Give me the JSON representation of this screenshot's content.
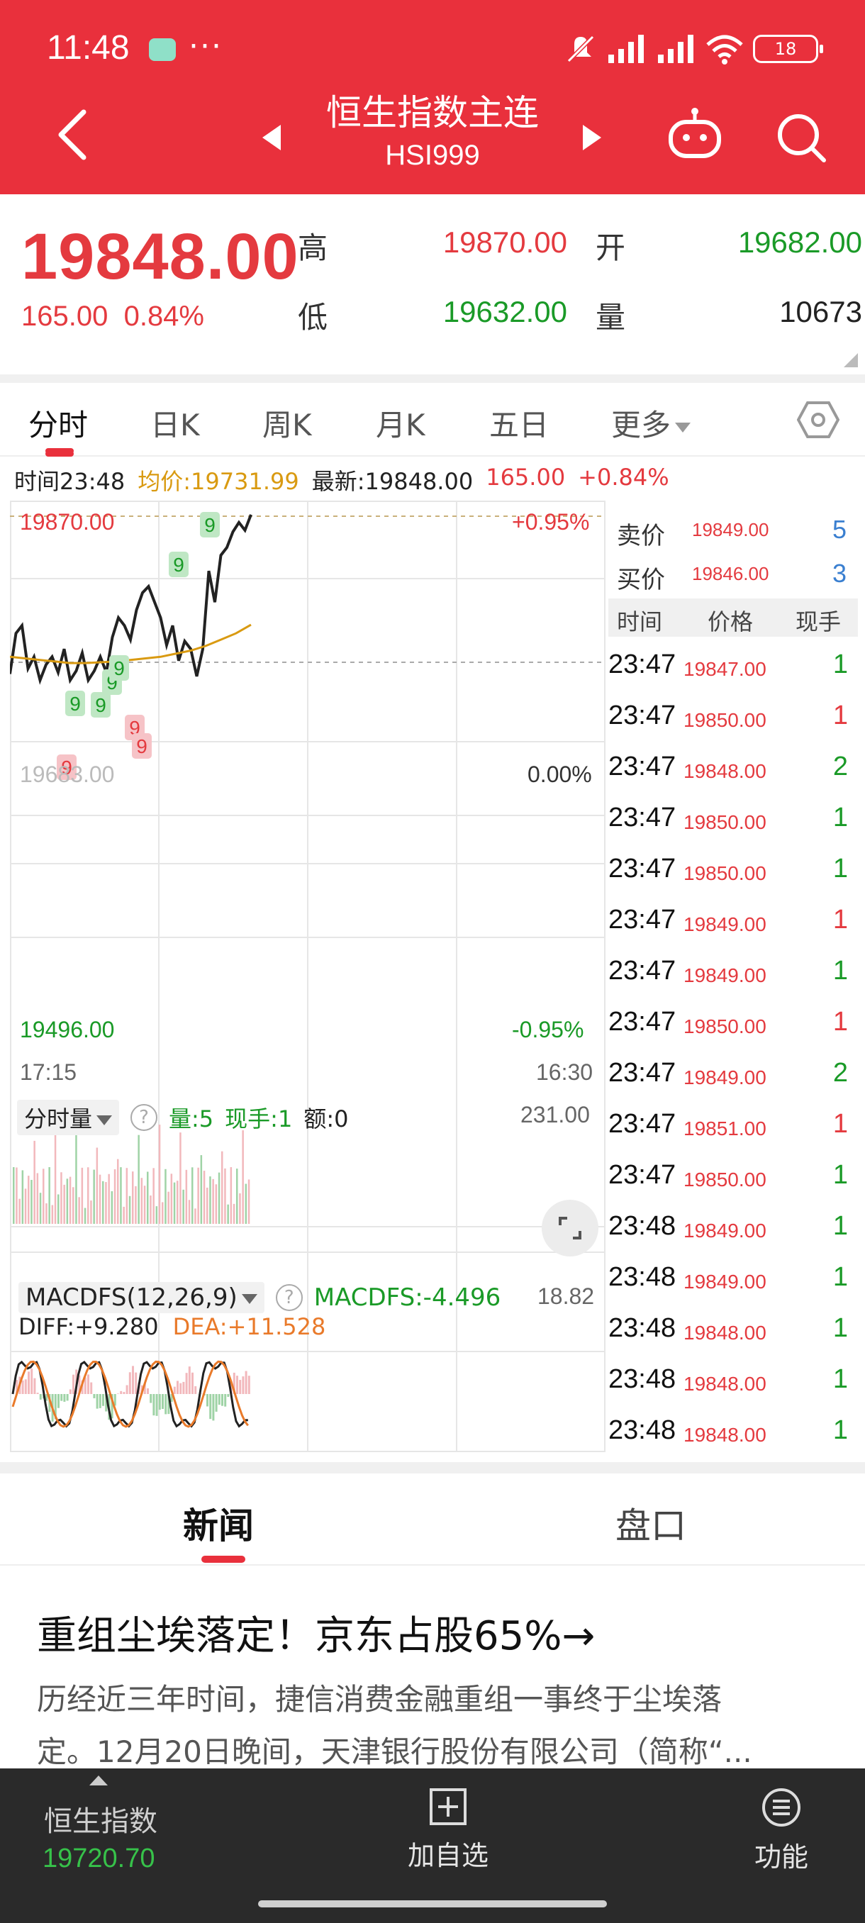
{
  "status_bar": {
    "time": "11:48",
    "dots": "···",
    "battery": "18"
  },
  "header": {
    "title": "恒生指数主连",
    "code": "HSI999"
  },
  "quote": {
    "price": "19848.00",
    "change": "165.00",
    "change_pct": "0.84%",
    "high_label": "高",
    "high": "19870.00",
    "open_label": "开",
    "open": "19682.00",
    "low_label": "低",
    "low": "19632.00",
    "volume_label": "量",
    "volume": "10673"
  },
  "tabs": [
    "分时",
    "日K",
    "周K",
    "月K",
    "五日",
    "更多"
  ],
  "info_line": {
    "time": "时间23:48",
    "avg": "均价:19731.99",
    "latest": "最新:19848.00",
    "chg": "165.00",
    "chg_pct": "+0.84%"
  },
  "axes": {
    "top": "19870.00",
    "top_pct": "+0.95%",
    "mid": "19683.00",
    "mid_pct": "0.00%",
    "bottom": "19496.00",
    "bottom_pct": "-0.95%",
    "start_time": "17:15",
    "end_time": "16:30"
  },
  "volume_panel": {
    "select": "分时量",
    "qty": "量:5",
    "hand": "现手:1",
    "amount": "额:0",
    "max": "231.00"
  },
  "macd_panel": {
    "select": "MACDFS(12,26,9)",
    "macdfs": "MACDFS:-4.496",
    "max": "18.82",
    "diff": "DIFF:+9.280",
    "dea": "DEA:+11.528"
  },
  "chart_data": {
    "type": "line",
    "series": [
      {
        "name": "",
        "values": [
          19668,
          19720,
          19730,
          19675,
          19690,
          19660,
          19680,
          19690,
          19670,
          19700,
          19660,
          19672,
          19695,
          19660,
          19672,
          19690,
          19670,
          19715,
          19740,
          19730,
          19712,
          19750,
          19772,
          19780,
          19760,
          19740,
          19705,
          19730,
          19685,
          19710,
          19700,
          19665,
          19700,
          19800,
          19760,
          19820,
          19830,
          19850,
          19862,
          19852,
          19872
        ]
      },
      {
        "name": "均价",
        "values": [
          19690,
          19688,
          19686,
          19684,
          19682,
          19682,
          19683,
          19684,
          19686,
          19688,
          19690,
          19694,
          19698,
          19704,
          19712,
          19720,
          19731
        ]
      }
    ],
    "ylim": [
      19496,
      19870
    ],
    "markers": [
      "9",
      "9",
      "9",
      "9",
      "9",
      "9",
      "9",
      "9",
      "9"
    ]
  },
  "order_book": {
    "sell_label": "卖价",
    "sell_price": "19849.00",
    "sell_qty": "5",
    "buy_label": "买价",
    "buy_price": "19846.00",
    "buy_qty": "3",
    "headers": [
      "时间",
      "价格",
      "现手"
    ],
    "trades": [
      {
        "time": "23:47",
        "price": "19847.00",
        "qty": "1",
        "dir": "green"
      },
      {
        "time": "23:47",
        "price": "19850.00",
        "qty": "1",
        "dir": "red"
      },
      {
        "time": "23:47",
        "price": "19848.00",
        "qty": "2",
        "dir": "green"
      },
      {
        "time": "23:47",
        "price": "19850.00",
        "qty": "1",
        "dir": "green"
      },
      {
        "time": "23:47",
        "price": "19850.00",
        "qty": "1",
        "dir": "green"
      },
      {
        "time": "23:47",
        "price": "19849.00",
        "qty": "1",
        "dir": "red"
      },
      {
        "time": "23:47",
        "price": "19849.00",
        "qty": "1",
        "dir": "green"
      },
      {
        "time": "23:47",
        "price": "19850.00",
        "qty": "1",
        "dir": "red"
      },
      {
        "time": "23:47",
        "price": "19849.00",
        "qty": "2",
        "dir": "green"
      },
      {
        "time": "23:47",
        "price": "19851.00",
        "qty": "1",
        "dir": "red"
      },
      {
        "time": "23:47",
        "price": "19850.00",
        "qty": "1",
        "dir": "green"
      },
      {
        "time": "23:48",
        "price": "19849.00",
        "qty": "1",
        "dir": "green"
      },
      {
        "time": "23:48",
        "price": "19849.00",
        "qty": "1",
        "dir": "green"
      },
      {
        "time": "23:48",
        "price": "19848.00",
        "qty": "1",
        "dir": "green"
      },
      {
        "time": "23:48",
        "price": "19848.00",
        "qty": "1",
        "dir": "green"
      },
      {
        "time": "23:48",
        "price": "19848.00",
        "qty": "1",
        "dir": "green"
      }
    ]
  },
  "news_tabs": {
    "news": "新闻",
    "book": "盘口"
  },
  "news": {
    "headline": "重组尘埃落定！京东占股65%→",
    "summary_line1": "历经近三年时间，捷信消费金融重组一事终于尘埃落",
    "summary_line2": "定。12月20日晚间，天津银行股份有限公司（简称“..."
  },
  "bottom_bar": {
    "index_name": "恒生指数",
    "index_value": "19720.70",
    "add_label": "加自选",
    "func_label": "功能"
  },
  "colors": {
    "brand_red": "#e9303c",
    "up_red": "#e43a3f",
    "down_green": "#1a9a27",
    "avg_orange": "#d99a11"
  }
}
